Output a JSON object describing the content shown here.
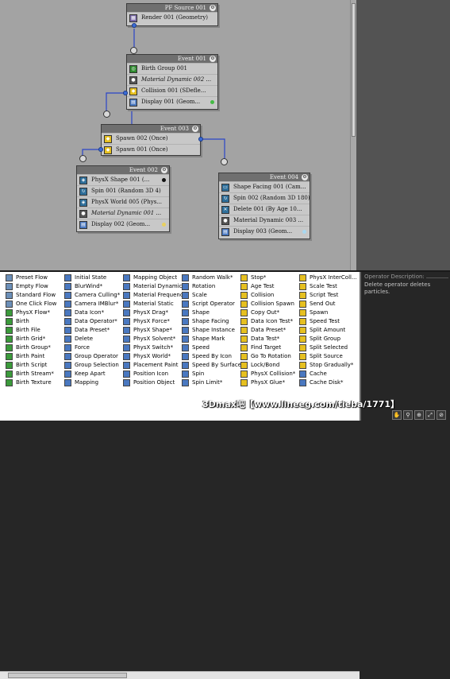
{
  "colors": {
    "graph_bg": "#a3a3a3",
    "node_bg": "#c8c8c8",
    "node_title_bg": "#6f6f6f",
    "wire": "#2a44c8",
    "desc_bg": "#262626"
  },
  "nodes": {
    "pf_source": {
      "title": "PF Source 001",
      "ops": [
        {
          "label": "Render 001 (Geometry)",
          "icon": "render-icon",
          "color": "#7a6aa8",
          "glyph": "▦",
          "italic": false
        }
      ]
    },
    "event001": {
      "title": "Event 001",
      "ops": [
        {
          "label": "Birth Group 001",
          "icon": "birth-group-icon",
          "color": "#2f8a2f",
          "glyph": "◎",
          "italic": false
        },
        {
          "label": "Material Dynamic 002 ...",
          "icon": "material-dynamic-icon",
          "color": "#555555",
          "glyph": "●",
          "italic": true
        },
        {
          "label": "Collision 001 (SDefle...",
          "icon": "collision-test-icon",
          "color": "#e6c020",
          "glyph": "◆",
          "italic": false
        },
        {
          "label": "Display 001 (Geom...",
          "icon": "display-icon",
          "color": "#4a78c0",
          "glyph": "▤",
          "italic": false,
          "dot": "#44bb44"
        }
      ]
    },
    "event003": {
      "title": "Event 003",
      "ops": [
        {
          "label": "Spawn 002 (Once)",
          "icon": "spawn-test-icon",
          "color": "#e6c020",
          "glyph": "◆",
          "italic": false
        },
        {
          "label": "Spawn 001 (Once)",
          "icon": "spawn-test-icon",
          "color": "#e6c020",
          "glyph": "◆",
          "italic": false
        }
      ]
    },
    "event002": {
      "title": "Event 002",
      "ops": [
        {
          "label": "PhysX Shape 001 (...",
          "icon": "physx-shape-icon",
          "color": "#2f6f9a",
          "glyph": "◈",
          "italic": false,
          "dot": "#111111"
        },
        {
          "label": "Spin 001 (Random 3D 4)",
          "icon": "spin-icon",
          "color": "#2f6f9a",
          "glyph": "↻",
          "italic": false
        },
        {
          "label": "PhysX World 005 (Phys...",
          "icon": "physx-world-icon",
          "color": "#2f6f9a",
          "glyph": "◈",
          "italic": false
        },
        {
          "label": "Material Dynamic 001 ...",
          "icon": "material-dynamic-icon",
          "color": "#555555",
          "glyph": "●",
          "italic": true
        },
        {
          "label": "Display 002 (Geom...",
          "icon": "display-icon",
          "color": "#4a78c0",
          "glyph": "▤",
          "italic": false,
          "dot": "#e8d060"
        }
      ]
    },
    "event004": {
      "title": "Event 004",
      "ops": [
        {
          "label": "Shape Facing 001 (Cam...",
          "icon": "shape-facing-icon",
          "color": "#2f6f9a",
          "glyph": "▭",
          "italic": false
        },
        {
          "label": "Spin 002 (Random 3D 180)",
          "icon": "spin-icon",
          "color": "#2f6f9a",
          "glyph": "↻",
          "italic": false
        },
        {
          "label": "Delete 001 (By Age 10...",
          "icon": "delete-icon",
          "color": "#2f6f9a",
          "glyph": "✕",
          "italic": false
        },
        {
          "label": "Material Dynamic 003 ...",
          "icon": "material-dynamic-icon",
          "color": "#555555",
          "glyph": "●",
          "italic": false
        },
        {
          "label": "Display 003 (Geom...",
          "icon": "display-icon",
          "color": "#4a78c0",
          "glyph": "▤",
          "italic": false,
          "dot": "#a8d8f0"
        }
      ]
    }
  },
  "depot": {
    "columns": [
      [
        {
          "label": "Preset Flow",
          "icon": "preset-flow-icon",
          "color": "#6b8fb8"
        },
        {
          "label": "Empty Flow",
          "icon": "empty-flow-icon",
          "color": "#6b8fb8"
        },
        {
          "label": "Standard Flow",
          "icon": "standard-flow-icon",
          "color": "#6b8fb8"
        },
        {
          "label": "One Click Flow",
          "icon": "one-click-flow-icon",
          "color": "#6b8fb8"
        },
        {
          "label": "PhysX Flow*",
          "icon": "physx-flow-icon",
          "color": "#3b9a3b"
        },
        {
          "label": "Birth",
          "icon": "birth-icon",
          "color": "#3b9a3b"
        },
        {
          "label": "Birth File",
          "icon": "birth-file-icon",
          "color": "#3b9a3b"
        },
        {
          "label": "Birth Grid*",
          "icon": "birth-grid-icon",
          "color": "#3b9a3b"
        },
        {
          "label": "Birth Group*",
          "icon": "birth-group-icon",
          "color": "#3b9a3b"
        },
        {
          "label": "Birth Paint",
          "icon": "birth-paint-icon",
          "color": "#3b9a3b"
        },
        {
          "label": "Birth Script",
          "icon": "birth-script-icon",
          "color": "#3b9a3b"
        },
        {
          "label": "Birth Stream*",
          "icon": "birth-stream-icon",
          "color": "#3b9a3b"
        },
        {
          "label": "Birth Texture",
          "icon": "birth-texture-icon",
          "color": "#3b9a3b"
        }
      ],
      [
        {
          "label": "Initial State",
          "icon": "initial-state-icon",
          "color": "#4a78c0"
        },
        {
          "label": "BlurWind*",
          "icon": "blurwind-icon",
          "color": "#4a78c0"
        },
        {
          "label": "Camera Culling*",
          "icon": "camera-culling-icon",
          "color": "#4a78c0"
        },
        {
          "label": "Camera IMBlur*",
          "icon": "camera-imblur-icon",
          "color": "#4a78c0"
        },
        {
          "label": "Data Icon*",
          "icon": "data-icon-icon",
          "color": "#4a78c0"
        },
        {
          "label": "Data Operator*",
          "icon": "data-operator-icon",
          "color": "#4a78c0"
        },
        {
          "label": "Data Preset*",
          "icon": "data-preset-icon",
          "color": "#4a78c0"
        },
        {
          "label": "Delete",
          "icon": "delete-icon",
          "color": "#4a78c0"
        },
        {
          "label": "Force",
          "icon": "force-icon",
          "color": "#4a78c0"
        },
        {
          "label": "Group Operator",
          "icon": "group-operator-icon",
          "color": "#4a78c0"
        },
        {
          "label": "Group Selection",
          "icon": "group-selection-icon",
          "color": "#4a78c0"
        },
        {
          "label": "Keep Apart",
          "icon": "keep-apart-icon",
          "color": "#4a78c0"
        },
        {
          "label": "Mapping",
          "icon": "mapping-icon",
          "color": "#4a78c0"
        }
      ],
      [
        {
          "label": "Mapping Object",
          "icon": "mapping-object-icon",
          "color": "#4a78c0"
        },
        {
          "label": "Material Dynamic",
          "icon": "material-dynamic-icon",
          "color": "#4a78c0"
        },
        {
          "label": "Material Frequency",
          "icon": "material-frequency-icon",
          "color": "#4a78c0"
        },
        {
          "label": "Material Static",
          "icon": "material-static-icon",
          "color": "#4a78c0"
        },
        {
          "label": "PhysX Drag*",
          "icon": "physx-drag-icon",
          "color": "#4a78c0"
        },
        {
          "label": "PhysX Force*",
          "icon": "physx-force-icon",
          "color": "#4a78c0"
        },
        {
          "label": "PhysX Shape*",
          "icon": "physx-shape-icon",
          "color": "#4a78c0"
        },
        {
          "label": "PhysX Solvent*",
          "icon": "physx-solvent-icon",
          "color": "#4a78c0"
        },
        {
          "label": "PhysX Switch*",
          "icon": "physx-switch-icon",
          "color": "#4a78c0"
        },
        {
          "label": "PhysX World*",
          "icon": "physx-world-icon",
          "color": "#4a78c0"
        },
        {
          "label": "Placement Paint",
          "icon": "placement-paint-icon",
          "color": "#4a78c0"
        },
        {
          "label": "Position Icon",
          "icon": "position-icon-icon",
          "color": "#4a78c0"
        },
        {
          "label": "Position Object",
          "icon": "position-object-icon",
          "color": "#4a78c0"
        }
      ],
      [
        {
          "label": "Random Walk*",
          "icon": "random-walk-icon",
          "color": "#4a78c0"
        },
        {
          "label": "Rotation",
          "icon": "rotation-icon",
          "color": "#4a78c0"
        },
        {
          "label": "Scale",
          "icon": "scale-icon",
          "color": "#4a78c0"
        },
        {
          "label": "Script Operator",
          "icon": "script-operator-icon",
          "color": "#4a78c0"
        },
        {
          "label": "Shape",
          "icon": "shape-icon",
          "color": "#4a78c0"
        },
        {
          "label": "Shape Facing",
          "icon": "shape-facing-icon",
          "color": "#4a78c0"
        },
        {
          "label": "Shape Instance",
          "icon": "shape-instance-icon",
          "color": "#4a78c0"
        },
        {
          "label": "Shape Mark",
          "icon": "shape-mark-icon",
          "color": "#4a78c0"
        },
        {
          "label": "Speed",
          "icon": "speed-icon",
          "color": "#4a78c0"
        },
        {
          "label": "Speed By Icon",
          "icon": "speed-by-icon-icon",
          "color": "#4a78c0"
        },
        {
          "label": "Speed By Surface",
          "icon": "speed-by-surface-icon",
          "color": "#4a78c0"
        },
        {
          "label": "Spin",
          "icon": "spin-icon",
          "color": "#4a78c0"
        },
        {
          "label": "Spin Limit*",
          "icon": "spin-limit-icon",
          "color": "#4a78c0"
        }
      ],
      [
        {
          "label": "Stop*",
          "icon": "stop-icon",
          "color": "#e6c020"
        },
        {
          "label": "Age Test",
          "icon": "age-test-icon",
          "color": "#e6c020"
        },
        {
          "label": "Collision",
          "icon": "collision-icon",
          "color": "#e6c020"
        },
        {
          "label": "Collision Spawn",
          "icon": "collision-spawn-icon",
          "color": "#e6c020"
        },
        {
          "label": "Copy Out*",
          "icon": "copy-out-icon",
          "color": "#e6c020"
        },
        {
          "label": "Data Icon Test*",
          "icon": "data-icon-test-icon",
          "color": "#e6c020"
        },
        {
          "label": "Data Preset*",
          "icon": "data-preset-test-icon",
          "color": "#e6c020"
        },
        {
          "label": "Data Test*",
          "icon": "data-test-icon",
          "color": "#e6c020"
        },
        {
          "label": "Find Target",
          "icon": "find-target-icon",
          "color": "#e6c020"
        },
        {
          "label": "Go To Rotation",
          "icon": "go-to-rotation-icon",
          "color": "#e6c020"
        },
        {
          "label": "Lock/Bond",
          "icon": "lock-bond-icon",
          "color": "#e6c020"
        },
        {
          "label": "PhysX Collision*",
          "icon": "physx-collision-icon",
          "color": "#e6c020"
        },
        {
          "label": "PhysX Glue*",
          "icon": "physx-glue-icon",
          "color": "#e6c020"
        }
      ],
      [
        {
          "label": "PhysX InterColl...",
          "icon": "physx-intercollision-icon",
          "color": "#e6c020"
        },
        {
          "label": "Scale Test",
          "icon": "scale-test-icon",
          "color": "#e6c020"
        },
        {
          "label": "Script Test",
          "icon": "script-test-icon",
          "color": "#e6c020"
        },
        {
          "label": "Send Out",
          "icon": "send-out-icon",
          "color": "#e6c020"
        },
        {
          "label": "Spawn",
          "icon": "spawn-icon",
          "color": "#e6c020"
        },
        {
          "label": "Speed Test",
          "icon": "speed-test-icon",
          "color": "#e6c020"
        },
        {
          "label": "Split Amount",
          "icon": "split-amount-icon",
          "color": "#e6c020"
        },
        {
          "label": "Split Group",
          "icon": "split-group-icon",
          "color": "#e6c020"
        },
        {
          "label": "Split Selected",
          "icon": "split-selected-icon",
          "color": "#e6c020"
        },
        {
          "label": "Split Source",
          "icon": "split-source-icon",
          "color": "#e6c020"
        },
        {
          "label": "Stop Gradually*",
          "icon": "stop-gradually-icon",
          "color": "#e6c020"
        },
        {
          "label": "Cache",
          "icon": "cache-icon",
          "color": "#4a78c0"
        },
        {
          "label": "Cache Disk*",
          "icon": "cache-disk-icon",
          "color": "#4a78c0"
        }
      ]
    ]
  },
  "description": {
    "title": "Operator Description:",
    "text": "Delete operator deletes particles."
  },
  "watermark": "3Dmax吧【www.lineeg.com/tieba/1771】",
  "nav_icons": [
    "hand-pan-icon",
    "zoom-icon",
    "zoom-region-icon",
    "zoom-extents-icon",
    "no-zoom-icon"
  ]
}
